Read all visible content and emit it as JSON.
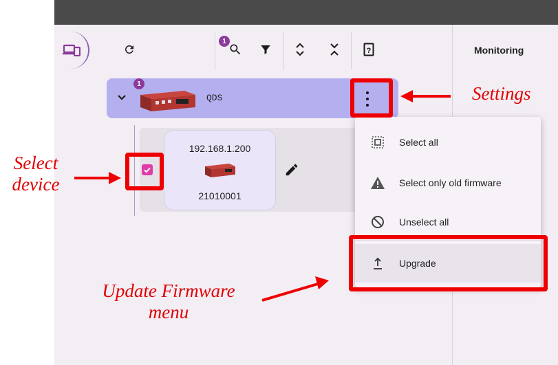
{
  "header": {
    "monitoring_label": "Monitoring"
  },
  "toolbar": {
    "items": [
      {
        "name": "devices-view",
        "icon": "devices-icon"
      },
      {
        "name": "refresh",
        "icon": "refresh-icon"
      },
      {
        "name": "search",
        "icon": "search-icon",
        "badge": "1"
      },
      {
        "name": "filter",
        "icon": "filter-icon"
      },
      {
        "name": "expand-all",
        "icon": "expand-icon"
      },
      {
        "name": "collapse-all",
        "icon": "collapse-icon"
      },
      {
        "name": "help",
        "icon": "help-icon"
      }
    ]
  },
  "device_group": {
    "name": "QDS",
    "badge": "1",
    "icon": "chevron-down-icon"
  },
  "device": {
    "ip": "192.168.1.200",
    "serial": "21010001",
    "selected": true
  },
  "menu": {
    "items": [
      {
        "label": "Select all",
        "icon": "select-all-icon"
      },
      {
        "label": "Select only old firmware",
        "icon": "warning-icon"
      },
      {
        "label": "Unselect all",
        "icon": "block-icon"
      },
      {
        "label": "Upgrade",
        "icon": "upload-icon"
      }
    ]
  },
  "annotations": {
    "settings": "Settings",
    "select_device": [
      "Select",
      "device"
    ],
    "update_firmware": [
      "Update Firmware",
      "menu"
    ]
  },
  "colors": {
    "annotation_red": "#ee0000",
    "group_row": "#b4b0ef",
    "badge": "#8b3a9b",
    "checkbox": "#e03ca9",
    "top_bar": "#4a4a4a"
  }
}
